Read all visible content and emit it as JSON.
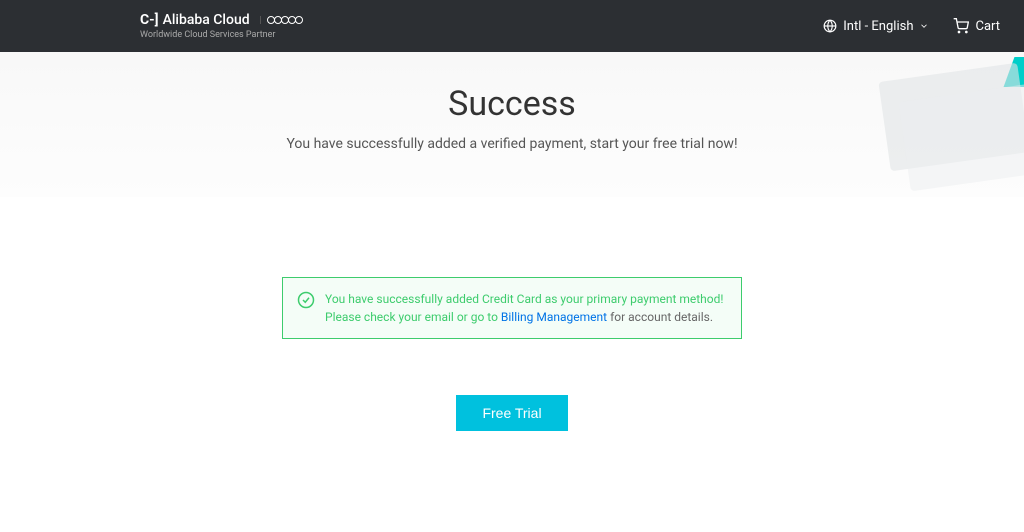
{
  "header": {
    "brand": "Alibaba Cloud",
    "tagline": "Worldwide Cloud Services Partner",
    "language": "Intl - English",
    "cart": "Cart"
  },
  "hero": {
    "title": "Success",
    "subtitle": "You have successfully added a verified payment, start your free trial now!"
  },
  "alert": {
    "line1": "You have successfully added Credit Card as your primary payment method!",
    "line2_prefix": "Please check your email or go to ",
    "line2_link": "Billing Management",
    "line2_suffix": " for account details."
  },
  "cta": {
    "label": "Free Trial"
  }
}
